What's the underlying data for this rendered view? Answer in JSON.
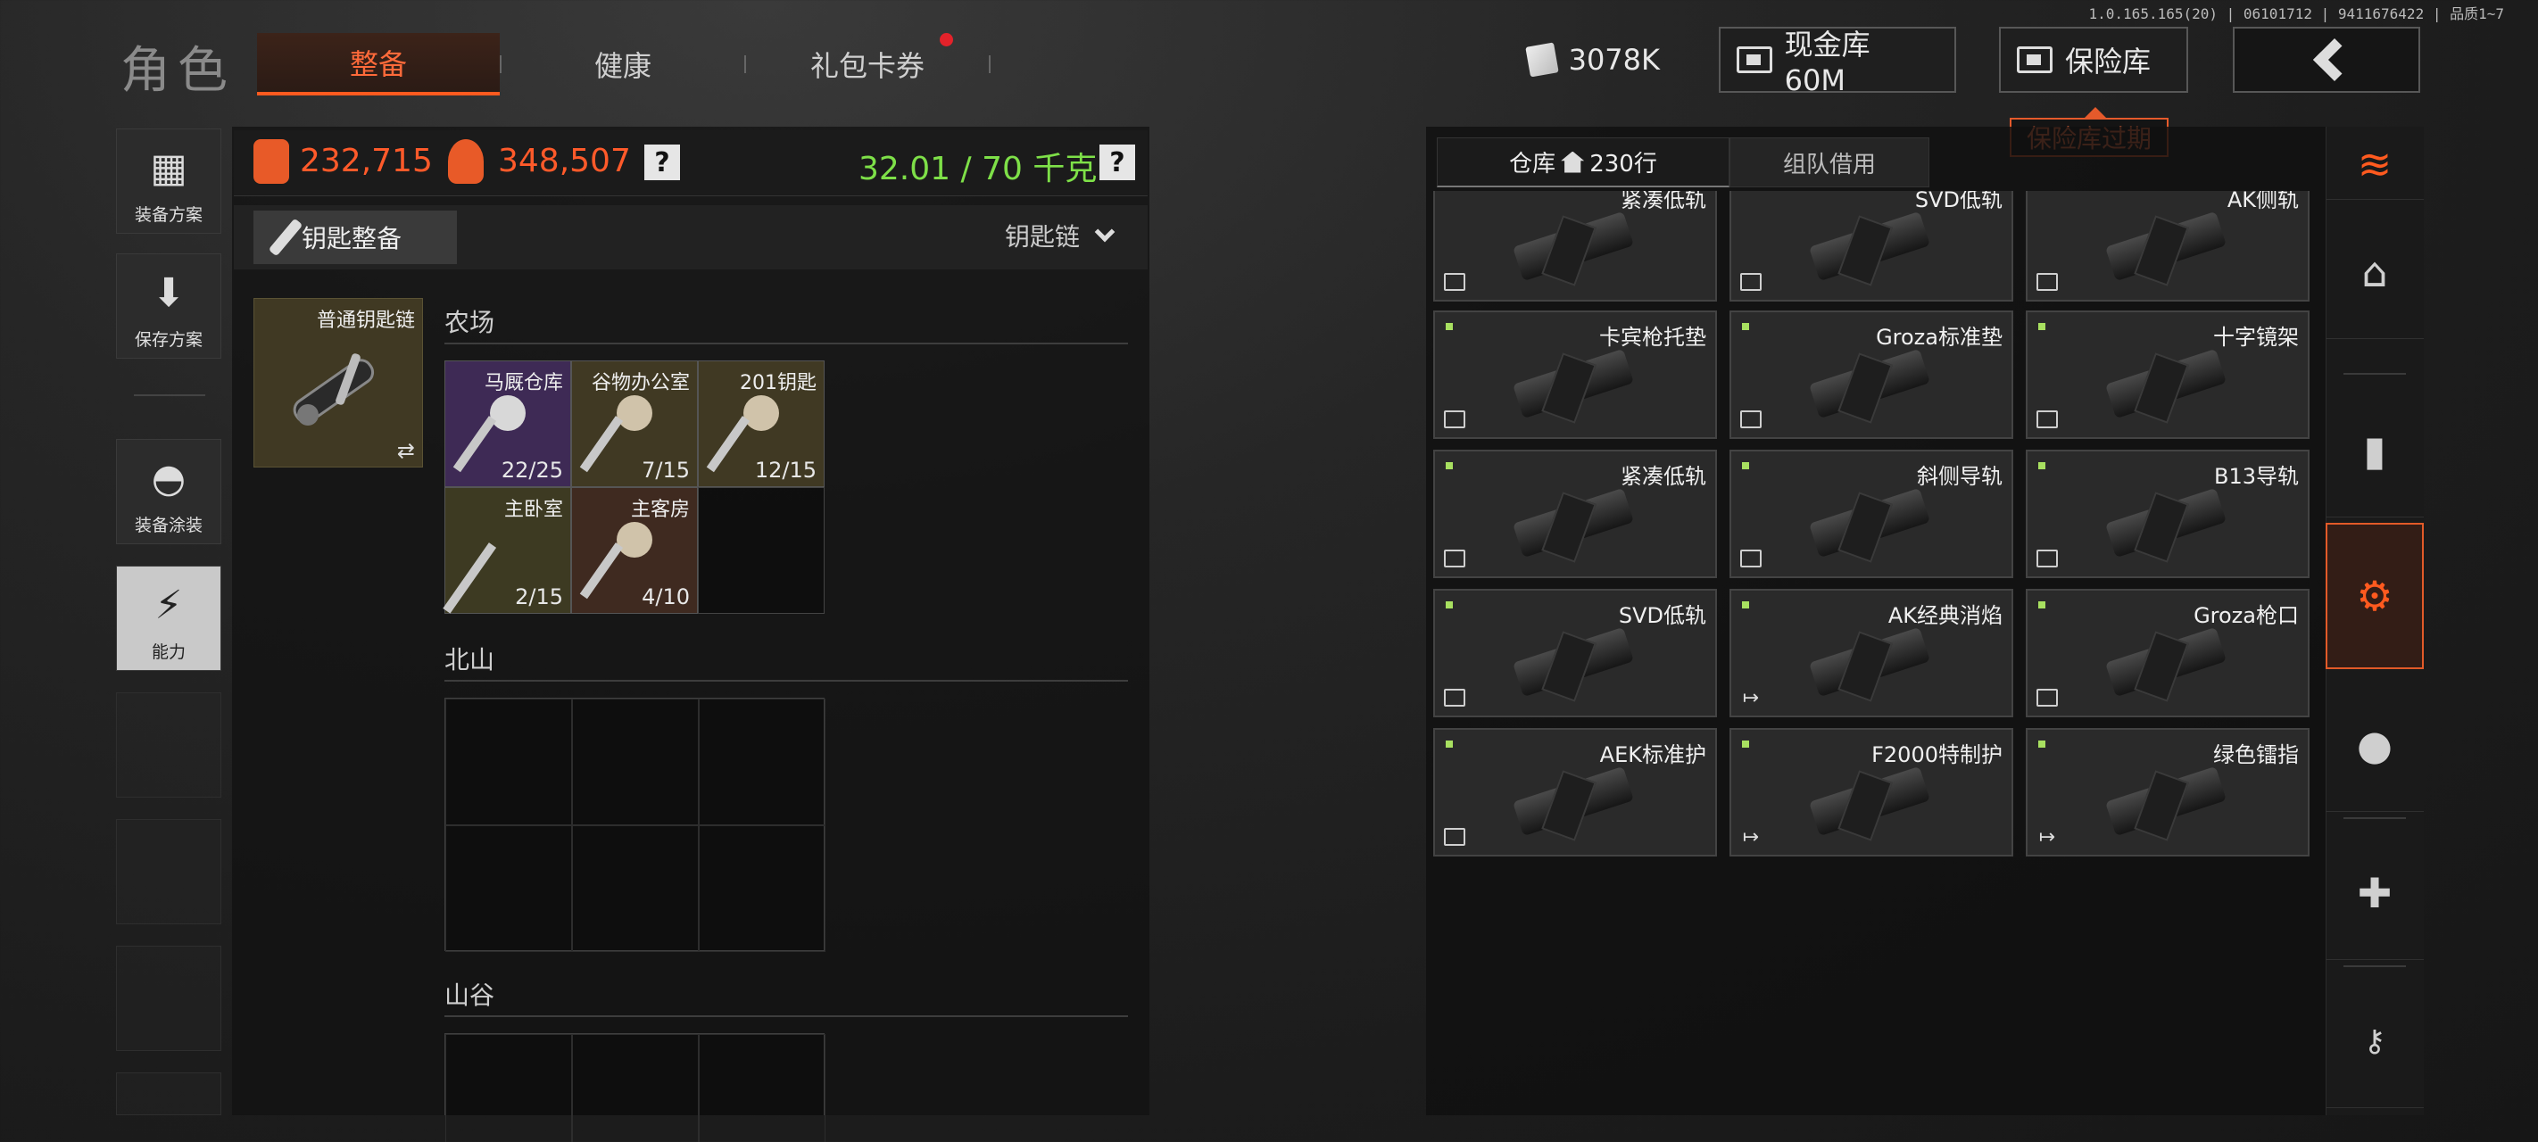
{
  "version_text": "1.0.165.165(20) | 06101712 | 9411676422 | 品质1~7",
  "title": "角色",
  "tabs": [
    {
      "label": "整备",
      "active": true
    },
    {
      "label": "健康",
      "active": false
    },
    {
      "label": "礼包卡券",
      "active": false,
      "notification": true
    }
  ],
  "header": {
    "cash": "3078K",
    "cash_vault": "现金库 60M",
    "safe": "保险库",
    "safe_tooltip": "保险库过期"
  },
  "sidebar": [
    {
      "label": "装备方案",
      "icon": "vest-icon"
    },
    {
      "label": "保存方案",
      "icon": "download-icon"
    },
    {
      "label": "装备涂装",
      "icon": "helmet-icon"
    },
    {
      "label": "能力",
      "icon": "lightning-icon",
      "active": true
    }
  ],
  "stats": {
    "armor_value": "232,715",
    "bag_value": "348,507",
    "help": "?",
    "weight": "32.01 / 70 千克"
  },
  "keys_bar": {
    "button": "钥匙整备",
    "dropdown": "钥匙链"
  },
  "keychain_slot": {
    "label": "普通钥匙链",
    "swap": "⇄"
  },
  "sections": [
    {
      "name": "农场",
      "keys": [
        {
          "name": "马厩仓库",
          "count": "22/25",
          "bg": "#3e2a55"
        },
        {
          "name": "谷物办公室",
          "count": "7/15",
          "bg": "#403923"
        },
        {
          "name": "201钥匙",
          "count": "12/15",
          "bg": "#403923"
        },
        {
          "name": "主卧室",
          "count": "2/15",
          "bg": "#3d3a22"
        },
        {
          "name": "主客房",
          "count": "4/10",
          "bg": "#3f2a20"
        }
      ]
    },
    {
      "name": "北山",
      "keys": []
    },
    {
      "name": "山谷",
      "keys": []
    }
  ],
  "warehouse": {
    "tab_warehouse": "仓库",
    "rows": "230行",
    "tab_team": "组队借用",
    "items": [
      {
        "name": "紧凑低轨",
        "corner": "box"
      },
      {
        "name": "SVD低轨",
        "corner": "box"
      },
      {
        "name": "AK侧轨",
        "corner": "box"
      },
      {
        "name": "卡宾枪托垫",
        "corner": "box",
        "new": true
      },
      {
        "name": "Groza标准垫",
        "corner": "box",
        "new": true
      },
      {
        "name": "十字镜架",
        "corner": "box",
        "new": true
      },
      {
        "name": "紧凑低轨",
        "corner": "box",
        "new": true
      },
      {
        "name": "斜侧导轨",
        "corner": "box",
        "new": true
      },
      {
        "name": "B13导轨",
        "corner": "box",
        "new": true
      },
      {
        "name": "SVD低轨",
        "corner": "box",
        "new": true
      },
      {
        "name": "AK经典消焰",
        "corner": "exit",
        "new": true
      },
      {
        "name": "Groza枪口",
        "corner": "box",
        "new": true
      },
      {
        "name": "AEK标准护",
        "corner": "box",
        "new": true
      },
      {
        "name": "F2000特制护",
        "corner": "exit",
        "new": true
      },
      {
        "name": "绿色镭指",
        "corner": "exit",
        "new": true
      }
    ]
  },
  "right_rail": [
    "layers-refresh-icon",
    "home-icon",
    "ammo-icon",
    "weapon-parts-icon",
    "grenade-icon",
    "medical-icon",
    "key-icon"
  ],
  "colors": {
    "accent": "#ff5a1f",
    "weight_green": "#7ee048",
    "value_orange": "#ff5a2a"
  }
}
